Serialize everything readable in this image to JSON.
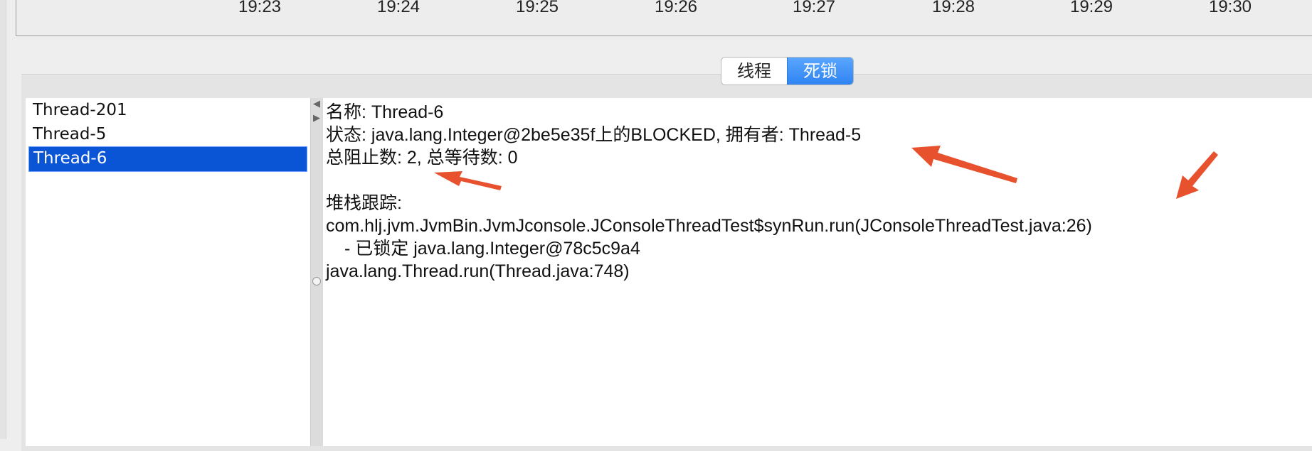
{
  "timeline": {
    "ticks": [
      "19:23",
      "19:24",
      "19:25",
      "19:26",
      "19:27",
      "19:28",
      "19:29",
      "19:30"
    ]
  },
  "tabs": {
    "threads_label": "线程",
    "deadlock_label": "死锁",
    "active": "死锁"
  },
  "thread_list": {
    "items": [
      {
        "label": "Thread-201"
      },
      {
        "label": "Thread-5"
      },
      {
        "label": "Thread-6"
      }
    ],
    "selected": "Thread-6"
  },
  "details": {
    "name_line": "名称: Thread-6",
    "state_line": "状态: java.lang.Integer@2be5e35f上的BLOCKED, 拥有者: Thread-5",
    "counts_line": "总阻止数: 2, 总等待数: 0",
    "stack_header": "堆栈跟踪:",
    "stack": [
      "com.hlj.jvm.JvmBin.JvmJconsole.JConsoleThreadTest$synRun.run(JConsoleThreadTest.java:26)",
      "- 已锁定 java.lang.Integer@78c5c9a4",
      "java.lang.Thread.run(Thread.java:748)"
    ]
  },
  "colors": {
    "selection": "#0a55d6",
    "tab_active": "#2f84f2",
    "annotation_arrow": "#e8512e"
  }
}
